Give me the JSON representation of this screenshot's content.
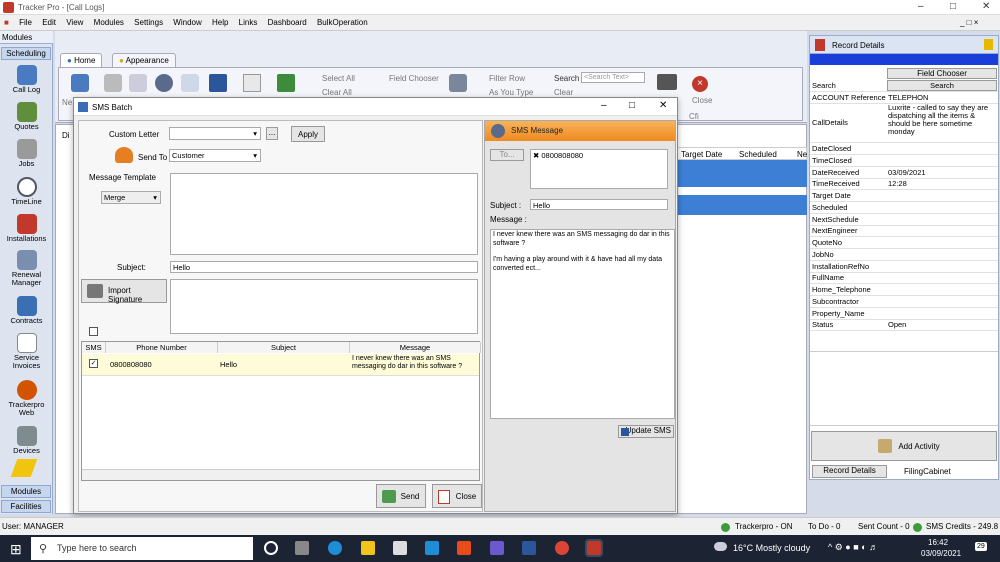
{
  "window": {
    "title": "Tracker Pro - [Call Logs]"
  },
  "menu": [
    "File",
    "Edit",
    "View",
    "Modules",
    "Settings",
    "Window",
    "Help",
    "Links",
    "Dashboard",
    "BulkOperation"
  ],
  "modules": {
    "header": "Modules",
    "scheduling": "Scheduling",
    "items": [
      "Call Log",
      "Quotes",
      "Jobs",
      "TimeLine",
      "Installations",
      "Renewal Manager",
      "Contracts",
      "Service Invoices",
      "Trackerpro Web",
      "Devices"
    ],
    "bottom_modules": "Modules",
    "bottom_facilities": "Facilities"
  },
  "ribbon": {
    "tab_home": "Home",
    "tab_appearance": "Appearance",
    "select_all": "Select All",
    "clear_all": "Clear All",
    "field_chooser": "Field Chooser",
    "filter_row": "Filter Row",
    "as_you_type": "As You Type",
    "search": "Search",
    "search_placeholder": "<Search Text>",
    "clear": "Clear",
    "close": "Close",
    "cfg": "Cfi",
    "ne": "Ne",
    "di": "Di"
  },
  "grid": {
    "headers": [
      "Target Date",
      "Scheduled",
      "Ne"
    ]
  },
  "dialog": {
    "title": "SMS Batch",
    "custom_letter_label": "Custom Letter",
    "custom_letter_value": "",
    "browse_btn": "...",
    "apply_btn": "Apply",
    "send_to_label": "Send To",
    "send_to_value": "Customer",
    "message_template_label": "Message Template",
    "merge_value": "Merge",
    "subject_label": "Subject:",
    "subject_value": "Hello",
    "import_signature": "Import Signature",
    "table_headers": [
      "SMS",
      "Phone Number",
      "Subject",
      "Message"
    ],
    "rows": [
      {
        "phone": "0800808080",
        "subject": "Hello",
        "message": "I never knew there was an SMS messaging do dar in this software ?"
      }
    ],
    "send_btn": "Send",
    "close_btn": "Close"
  },
  "sms_message": {
    "title": "SMS Message",
    "to_btn": "To...",
    "recipient": "0800808080",
    "subject_label": "Subject :",
    "subject_value": "Hello",
    "message_label": "Message :",
    "message_line1": "I never knew there was an SMS messaging do dar in this software ?",
    "message_line2": "I'm having a play around with it & have had all my data converted ect...",
    "update_btn": "Update SMS"
  },
  "record_details": {
    "title": "Record Details",
    "field_chooser": "Field Chooser",
    "search_label": "Search",
    "search_btn": "Search",
    "rows": [
      {
        "k": "ACCOUNT Reference",
        "v": "TELEPHON"
      },
      {
        "k": "CallDetails",
        "v": "Luxrite - called to say they are dispatching all the items & should be here sometime monday"
      },
      {
        "k": "DateClosed",
        "v": ""
      },
      {
        "k": "TimeClosed",
        "v": ""
      },
      {
        "k": "DateReceived",
        "v": "03/09/2021"
      },
      {
        "k": "TimeReceived",
        "v": "12:28"
      },
      {
        "k": "Target Date",
        "v": ""
      },
      {
        "k": "Scheduled",
        "v": ""
      },
      {
        "k": "NextSchedule",
        "v": ""
      },
      {
        "k": "NextEngineer",
        "v": ""
      },
      {
        "k": "QuoteNo",
        "v": ""
      },
      {
        "k": "JobNo",
        "v": ""
      },
      {
        "k": "InstallationRefNo",
        "v": ""
      },
      {
        "k": "FullName",
        "v": ""
      },
      {
        "k": "Home_Telephone",
        "v": ""
      },
      {
        "k": "Subcontractor",
        "v": ""
      },
      {
        "k": "Property_Name",
        "v": ""
      },
      {
        "k": "Status",
        "v": "Open"
      }
    ],
    "add_activity": "Add Activity",
    "tab_record": "Record Details",
    "tab_filing": "FilingCabinet"
  },
  "status": {
    "user": "User: MANAGER",
    "online": "Trackerpro - ON",
    "todo": "To Do - 0",
    "sent": "Sent Count - 0",
    "credits": "SMS Credits - 249.8"
  },
  "taskbar": {
    "search_placeholder": "Type here to search",
    "weather": "16°C  Mostly cloudy",
    "time": "16:42",
    "date": "03/09/2021",
    "badge": "29"
  }
}
